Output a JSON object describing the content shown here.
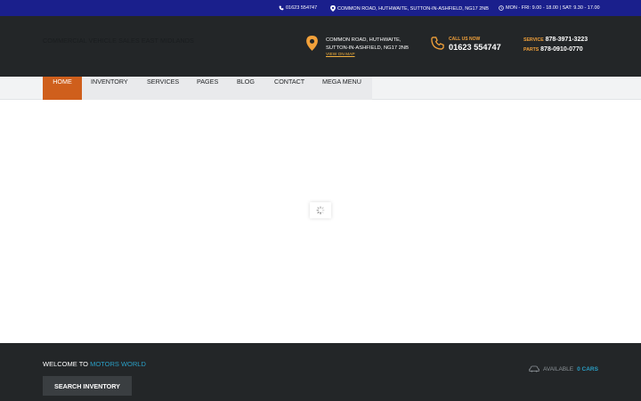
{
  "topbar": {
    "phone": "01623 554747",
    "address": "COMMON ROAD, HUTHWAITE, SUTTON-IN-ASHFIELD, NG17 2NB",
    "hours": "MON - FRI: 9.00 - 18.00 | SAT: 9.30 - 17.00"
  },
  "header": {
    "site_name": "COMMERCIAL VEHICLE SALES EAST MIDLANDS",
    "address_line1": "COMMON ROAD, HUTHWAITE,",
    "address_line2": "SUTTON-IN-ASHFIELD, NG17 2NB",
    "view_map": "VIEW ON MAP",
    "call_label": "CALL US NOW",
    "call_number": "01623 554747",
    "service_label": "SERVICE",
    "service_number": "878-3971-3223",
    "parts_label": "PARTS",
    "parts_number": "878-0910-0770"
  },
  "nav": {
    "items": [
      "HOME",
      "INVENTORY",
      "SERVICES",
      "PAGES",
      "BLOG",
      "CONTACT",
      "MEGA MENU"
    ],
    "active": "HOME"
  },
  "footer": {
    "welcome_prefix": "WELCOME TO",
    "welcome_brand": "MOTORS WORLD",
    "search_button": "SEARCH INVENTORY",
    "available_label": "AVAILABLE",
    "available_count": "0 CARS"
  },
  "colors": {
    "topbar": "#1a1f8c",
    "header": "#232628",
    "accent_orange": "#f2a13a",
    "active_tab": "#cf5f1c",
    "accent_blue": "#2a9ec4"
  }
}
